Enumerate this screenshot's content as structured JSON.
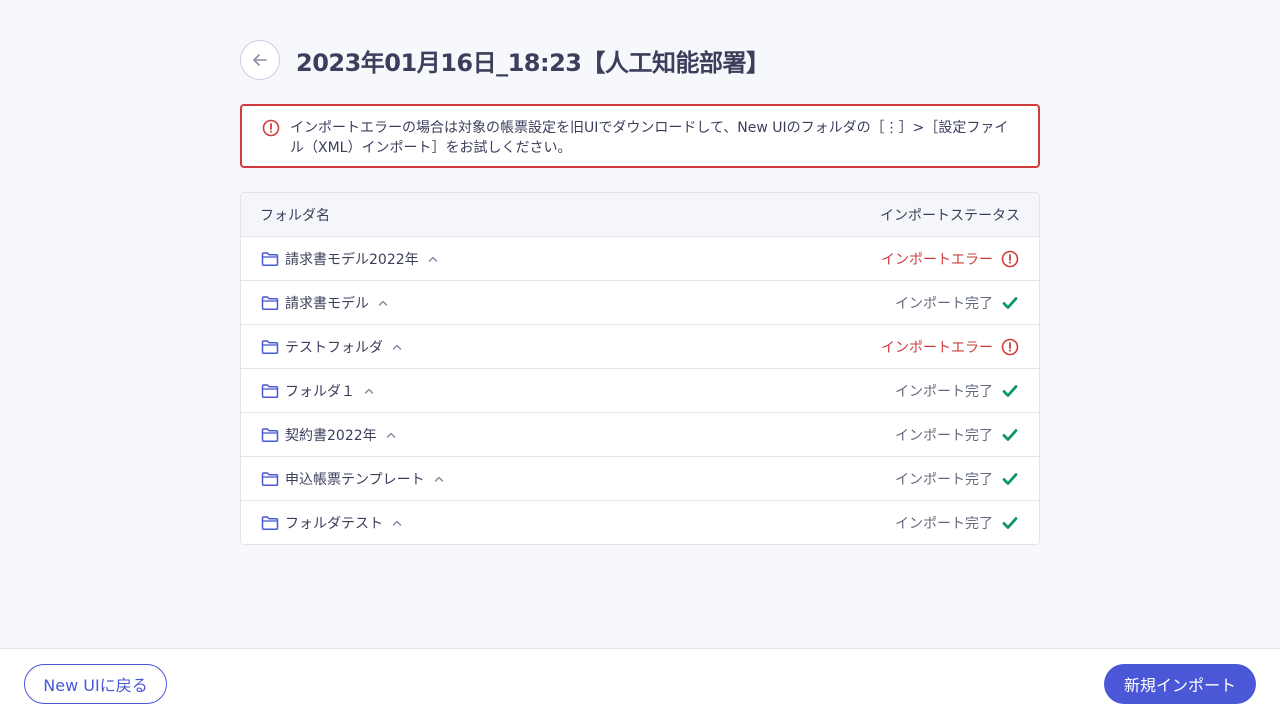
{
  "page": {
    "title": "2023年01月16日_18:23【人工知能部署】"
  },
  "alert": {
    "message": "インポートエラーの場合は対象の帳票設定を旧UIでダウンロードして、New UIのフォルダの［⋮］>［設定ファイル（XML）インポート］をお試しください。"
  },
  "table": {
    "col_folder": "フォルダ名",
    "col_status": "インポートステータス",
    "rows": [
      {
        "name": "請求書モデル2022年",
        "status": "インポートエラー",
        "state": "error"
      },
      {
        "name": "請求書モデル",
        "status": "インポート完了",
        "state": "done"
      },
      {
        "name": "テストフォルダ",
        "status": "インポートエラー",
        "state": "error"
      },
      {
        "name": "フォルダ１",
        "status": "インポート完了",
        "state": "done"
      },
      {
        "name": "契約書2022年",
        "status": "インポート完了",
        "state": "done"
      },
      {
        "name": "申込帳票テンプレート",
        "status": "インポート完了",
        "state": "done"
      },
      {
        "name": "フォルダテスト",
        "status": "インポート完了",
        "state": "done"
      }
    ]
  },
  "footer": {
    "back_label": "New UIに戻る",
    "new_import_label": "新規インポート"
  },
  "icons": {
    "back": "arrow-left-icon",
    "alert": "alert-circle-icon",
    "folder": "folder-icon",
    "chevron": "chevron-up-icon",
    "error": "error-circle-icon",
    "done": "check-icon"
  },
  "colors": {
    "accent": "#4a57d6",
    "error": "#d13b3b",
    "success": "#0e9470",
    "text": "#3b3f5c"
  }
}
